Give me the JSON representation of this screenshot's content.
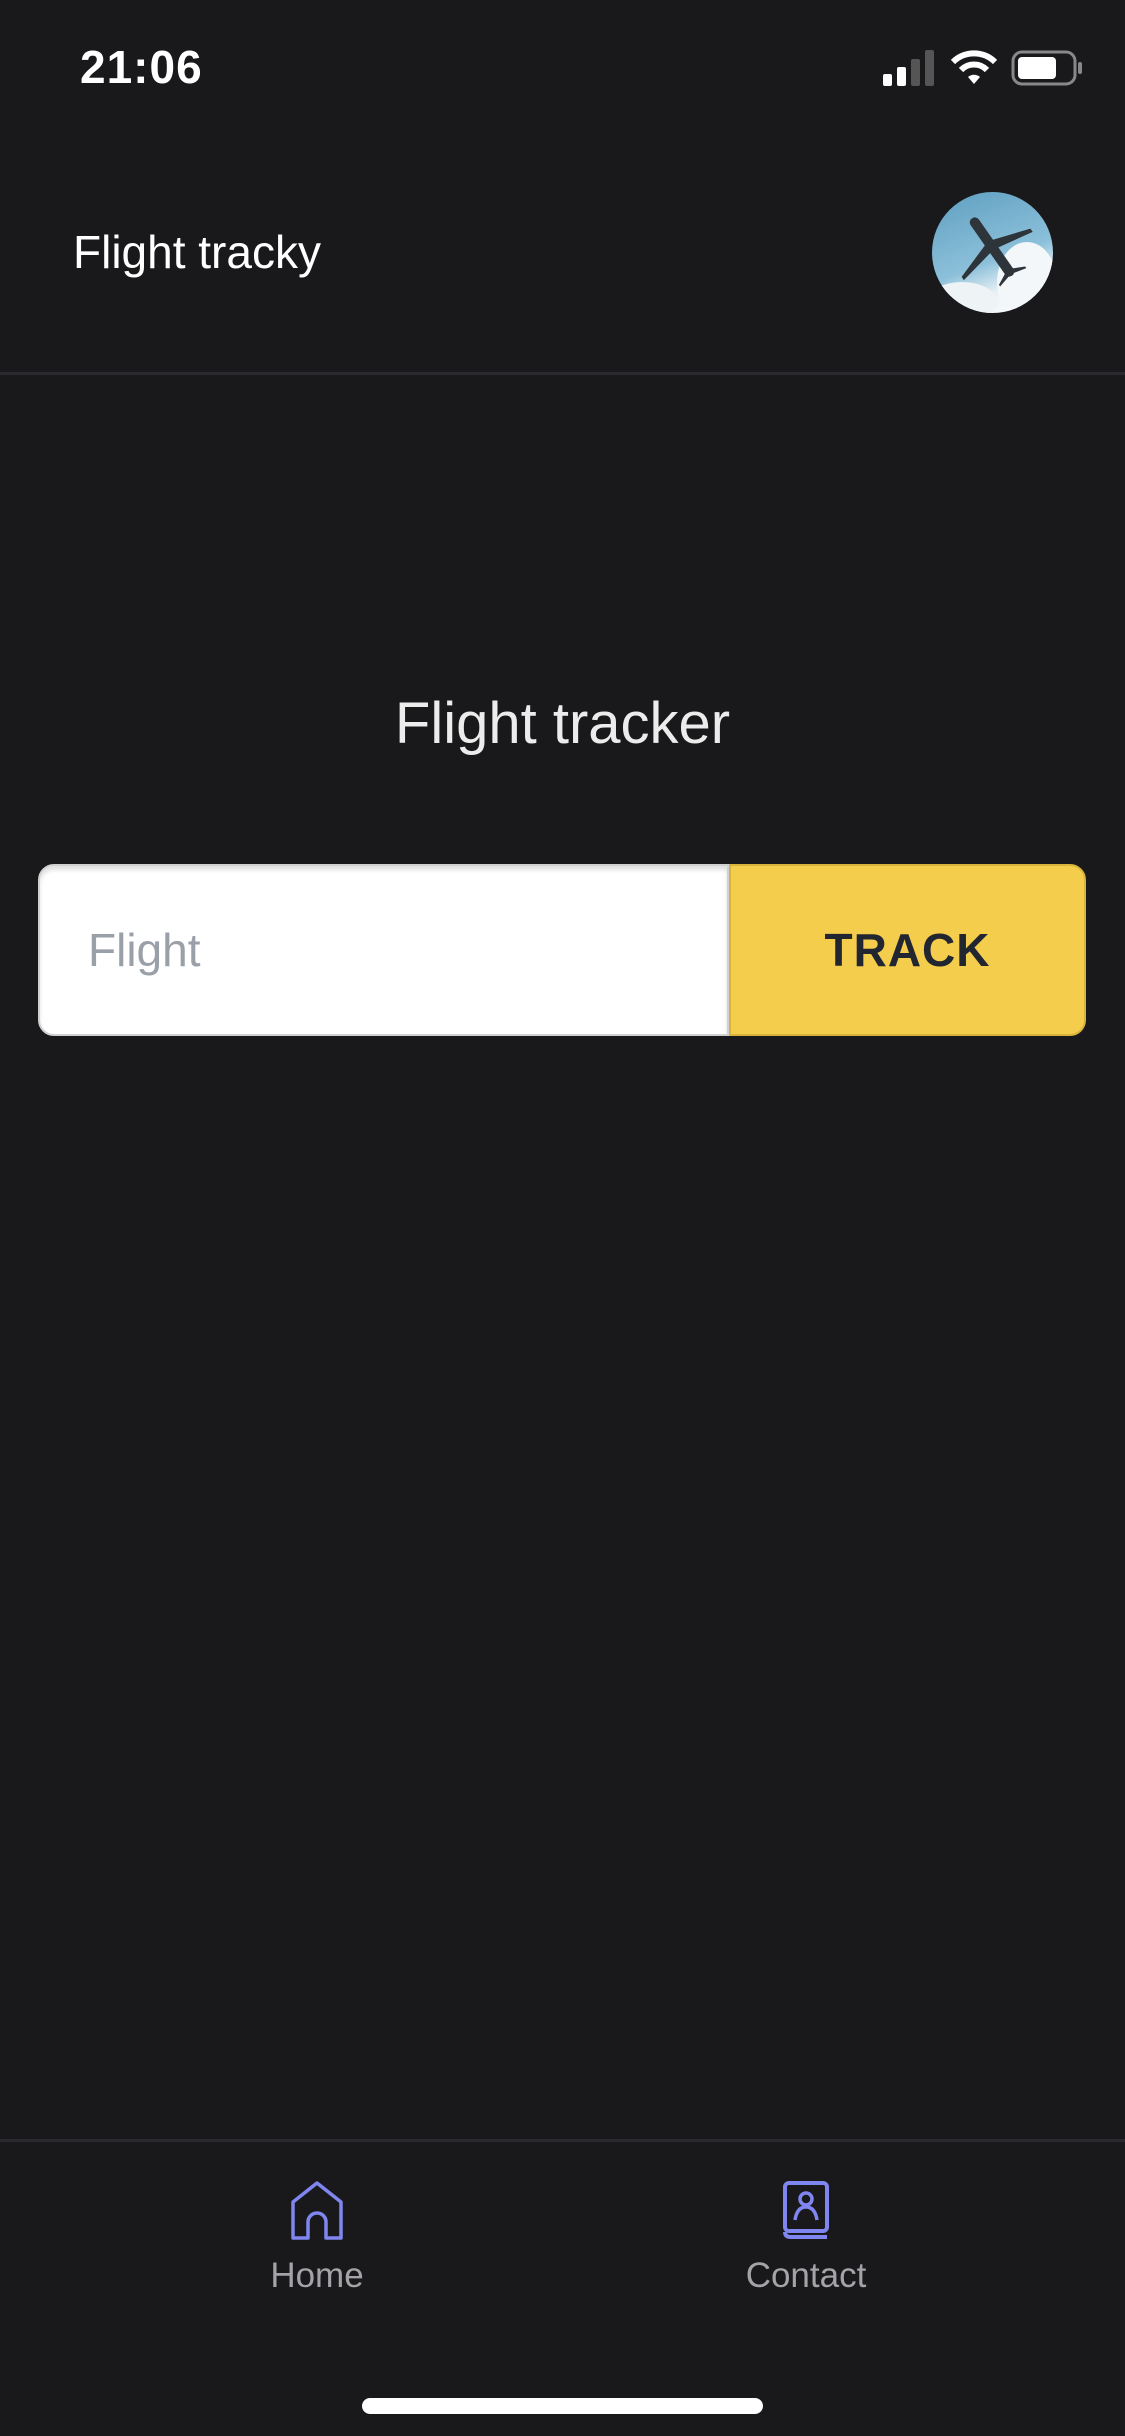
{
  "status_bar": {
    "time": "21:06",
    "icons": [
      "cellular-signal-icon",
      "wifi-icon",
      "battery-icon"
    ]
  },
  "header": {
    "title": "Flight tracky",
    "avatar": "airplane-avatar"
  },
  "main": {
    "title": "Flight tracker",
    "flight_input": {
      "value": "",
      "placeholder": "Flight"
    },
    "track_button": "TRACK"
  },
  "tab_bar": {
    "items": [
      {
        "label": "Home",
        "icon": "home-icon"
      },
      {
        "label": "Contact",
        "icon": "contact-icon"
      }
    ]
  },
  "colors": {
    "background": "#19191b",
    "accent": "#f3cd4b",
    "tab_icon": "#7f86f0",
    "tab_label": "#a3a3a8"
  }
}
